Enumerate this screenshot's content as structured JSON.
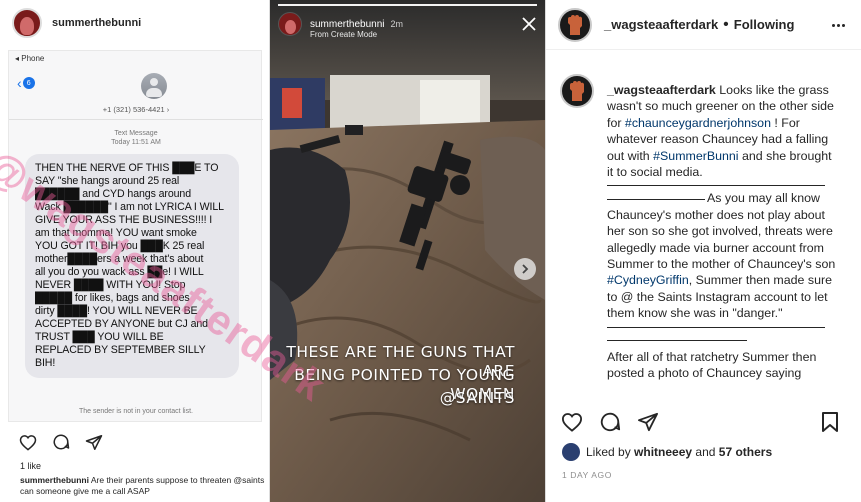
{
  "left_post": {
    "username": "summerthebunni",
    "sms": {
      "status_label": "Phone",
      "back_badge": "6",
      "phone_number": "+1 (321) 536-4421 ›",
      "message_type": "Text Message",
      "message_time": "Today 11:51 AM",
      "message_lines": [
        "THEN THE NERVE OF THIS ███E TO",
        "SAY \"she hangs around 25 real",
        "██████ and CYD hangs around",
        "Wack ██████\" I am not LYRICA I WILL",
        "GIVE YOUR ASS THE BUSINESS!!!! I",
        "am that momma! YOU want smoke",
        "YOU GOT IT! BIH you ███K 25 real",
        "mother████ers a week that's about",
        "all you do you wack ass ██e! I WILL",
        "NEVER ████ WITH YOU! Stop",
        "█████ for likes, bags and shoes",
        "dirty ████! YOU WILL NEVER BE",
        "ACCEPTED BY ANYONE but CJ and",
        "TRUST ███ YOU WILL BE",
        "REPLACED BY SEPTEMBER SILLY",
        "BIH!"
      ],
      "sender_note": "The sender is not in your contact list."
    },
    "likes": "1 like",
    "caption_user": "summerthebunni",
    "caption_text": "Are their parents suppose to threaten @saints can someone give me a call ASAP"
  },
  "watermark": "@wagsteaafterdark",
  "story": {
    "username": "summerthebunni",
    "time": "2m",
    "subtitle": "From Create Mode",
    "text_lines": [
      "THESE ARE THE GUNS THAT ARE",
      "BEING POINTED TO YOUNG WOMEN",
      "@SAINTS"
    ]
  },
  "right_post": {
    "username": "_wagsteaafterdark",
    "separator": "•",
    "follow_status": "Following",
    "caption": {
      "user": "_wagsteaafterdark",
      "p1_a": "Looks like the grass wasn't so much greener on the other side for",
      "tag1": "#chaunceygardnerjohnson",
      "p1_b": "! For whatever reason Chauncey had a falling out with",
      "tag2": "#SummerBunni",
      "p1_c": "and she brought it to social media.",
      "p2_a": "As you may all know Chauncey's mother does not play about her son so she got involved, threats were allegedly made via burner account from Summer to the mother of Chauncey's son",
      "tag3": "#CydneyGriffin",
      "p2_b": ", Summer then made sure to @ the Saints Instagram account to let them know she was in \"danger.\"",
      "p3": "After all of that ratchetry Summer then posted a photo of Chauncey saying"
    },
    "liked_by_prefix": "Liked by",
    "liked_by_user": "whitneeey",
    "liked_by_and": "and",
    "liked_by_others": "57 others",
    "time_ago": "1 DAY AGO"
  }
}
